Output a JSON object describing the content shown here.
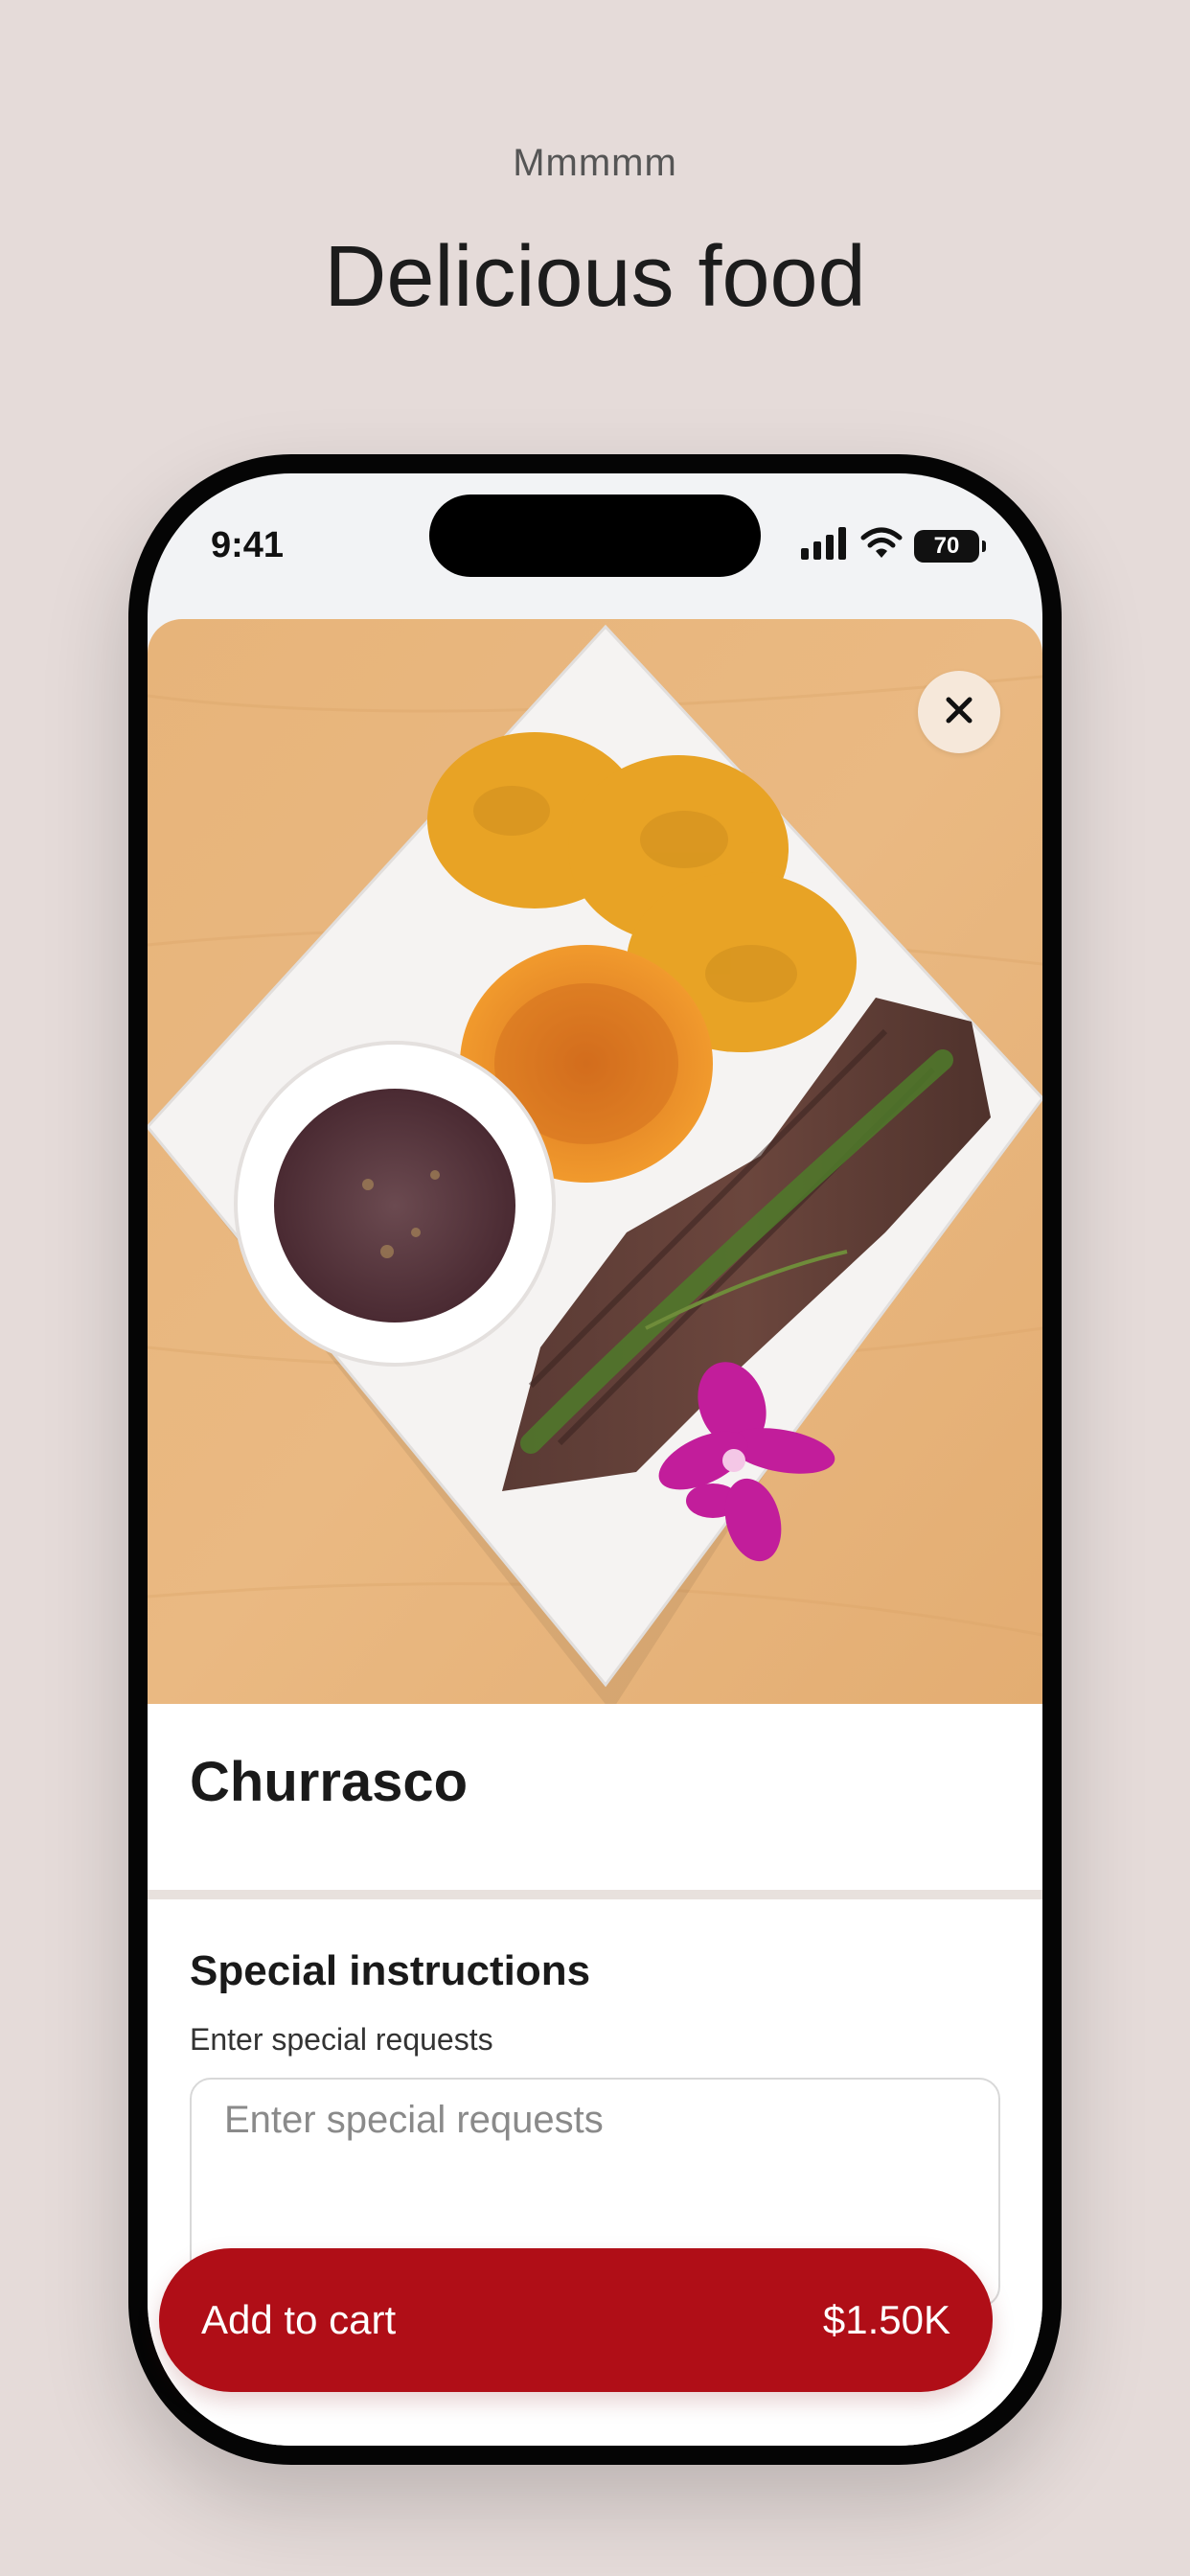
{
  "header": {
    "eyebrow": "Mmmmm",
    "headline": "Delicious food"
  },
  "status_bar": {
    "time": "9:41",
    "battery": "70",
    "icons": [
      "cellular-signal-icon",
      "wifi-icon",
      "battery-icon"
    ]
  },
  "item": {
    "photo_alt": "Churrasco",
    "name": "Churrasco",
    "close_icon": "close-icon"
  },
  "special_instructions": {
    "title": "Special instructions",
    "subtitle": "Enter special requests",
    "placeholder": "Enter special requests",
    "value": ""
  },
  "cart": {
    "label": "Add to cart",
    "price": "$1.50K"
  },
  "colors": {
    "background": "#e5dbd9",
    "accent": "#b00e17",
    "close_button": "#f6e8da"
  }
}
